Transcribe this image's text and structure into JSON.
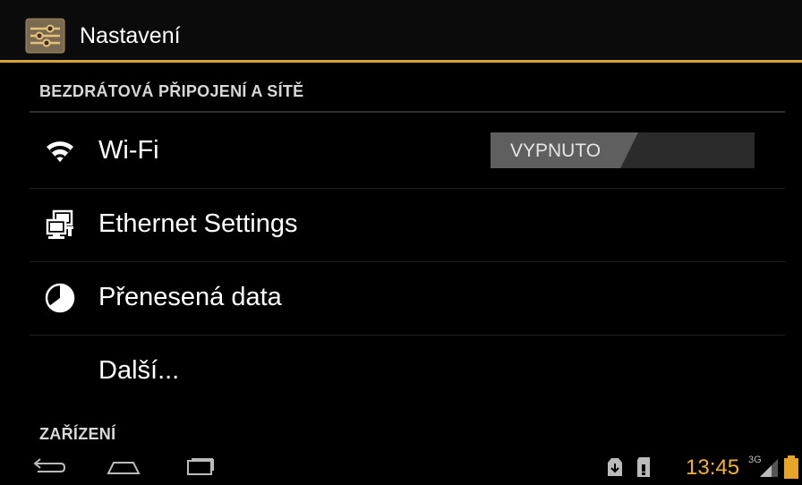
{
  "header": {
    "title": "Nastavení",
    "icon": "settings-sliders-icon",
    "accent_color": "#d7a33a"
  },
  "sections": {
    "wireless": {
      "title": "BEZDRÁTOVÁ PŘIPOJENÍ A SÍTĚ"
    },
    "device": {
      "title": "ZAŘÍZENÍ"
    }
  },
  "items": {
    "wifi": {
      "label": "Wi-Fi",
      "icon": "wifi-icon",
      "toggle_label": "VYPNUTO"
    },
    "ethernet": {
      "label": "Ethernet Settings",
      "icon": "ethernet-icon"
    },
    "data_usage": {
      "label": "Přenesená data",
      "icon": "data-usage-icon"
    },
    "more": {
      "label": "Další..."
    }
  },
  "status_bar": {
    "time": "13:45",
    "network": "3G",
    "time_color": "#f2b233",
    "icons": [
      "download-icon",
      "sd-card-icon",
      "signal-3g-icon",
      "battery-icon"
    ]
  },
  "navigation": {
    "buttons": [
      "back-icon",
      "home-icon",
      "recent-apps-icon"
    ]
  }
}
